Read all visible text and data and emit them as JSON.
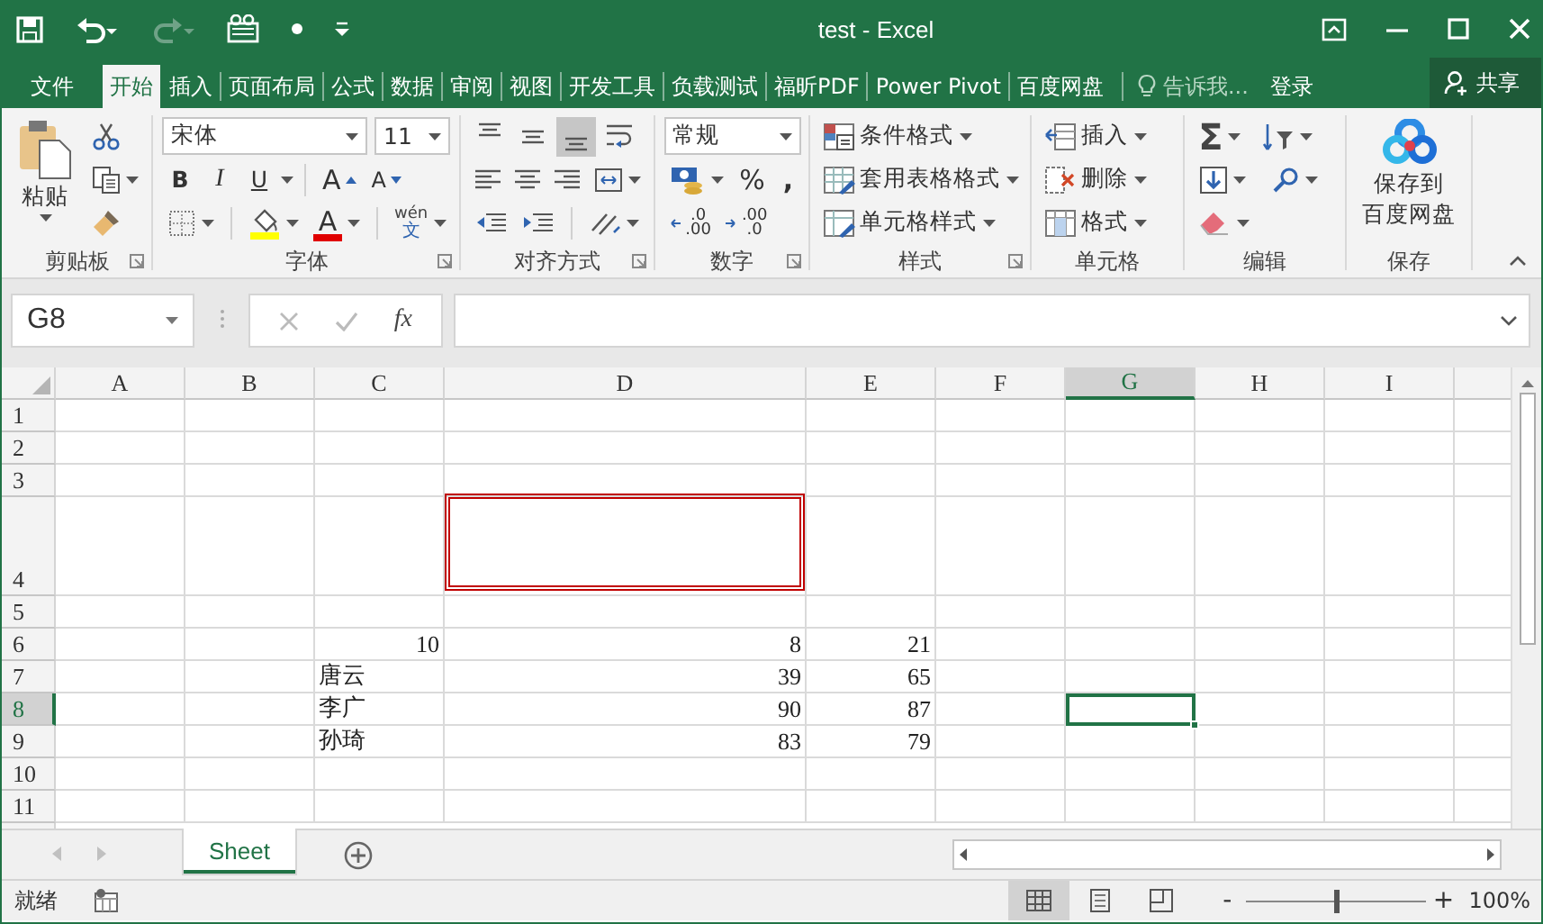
{
  "title_bar": {
    "title": "test - Excel",
    "quick_access": [
      {
        "kind": "save",
        "disabled": false
      },
      {
        "kind": "undo",
        "disabled": false
      },
      {
        "kind": "redo",
        "disabled": true
      },
      {
        "kind": "form",
        "disabled": false
      },
      {
        "kind": "dot",
        "disabled": false
      },
      {
        "kind": "customize",
        "disabled": false
      }
    ]
  },
  "ribbon_tabs": [
    {
      "label": "文件",
      "selected": false
    },
    {
      "label": "开始",
      "selected": true
    },
    {
      "label": "插入",
      "selected": false
    },
    {
      "label": "页面布局",
      "selected": false
    },
    {
      "label": "公式",
      "selected": false
    },
    {
      "label": "数据",
      "selected": false
    },
    {
      "label": "审阅",
      "selected": false
    },
    {
      "label": "视图",
      "selected": false
    },
    {
      "label": "开发工具",
      "selected": false
    },
    {
      "label": "负载测试",
      "selected": false
    },
    {
      "label": "福昕PDF",
      "selected": false
    },
    {
      "label": "Power Pivot",
      "selected": false
    },
    {
      "label": "百度网盘",
      "selected": false
    }
  ],
  "tell_me": {
    "placeholder": "告诉我..."
  },
  "sign_in": "登录",
  "share": "共享",
  "ribbon_groups": [
    {
      "kind": "clipboard",
      "label": "剪贴板",
      "launcher": true,
      "paste": "粘贴"
    },
    {
      "kind": "font",
      "label": "字体",
      "launcher": true,
      "font_name": "宋体",
      "font_size": "11",
      "bold": "B",
      "italic": "I",
      "underline": "U",
      "grow_font": "A",
      "shrink_font": "A",
      "font_color": "A",
      "phonetic": [
        "wén",
        "文"
      ]
    },
    {
      "kind": "alignment",
      "label": "对齐方式",
      "launcher": true,
      "vertical_align_buttons": [
        {
          "selected": false
        },
        {
          "selected": false
        },
        {
          "selected": true
        }
      ]
    },
    {
      "kind": "number",
      "label": "数字",
      "launcher": true,
      "format": "常规",
      "percent": "%",
      "comma": ",",
      "increase_decimal": [
        ".0",
        ".00"
      ],
      "decrease_decimal": [
        ".00",
        ".0"
      ]
    },
    {
      "kind": "styles",
      "label": "样式",
      "launcher": true,
      "buttons": [
        "条件格式",
        "套用表格格式",
        "单元格样式"
      ]
    },
    {
      "kind": "cells",
      "label": "单元格",
      "launcher": false,
      "buttons": [
        "插入",
        "删除",
        "格式"
      ]
    },
    {
      "kind": "editing",
      "label": "编辑",
      "launcher": false,
      "autosum": "Σ"
    },
    {
      "kind": "save",
      "label": "保存",
      "launcher": false,
      "button_lines": [
        "保存到",
        "百度网盘"
      ]
    }
  ],
  "formula_bar": {
    "name_box": "G8",
    "function_button": "fx"
  },
  "grid": {
    "columns": [
      {
        "label": "A",
        "selected": false
      },
      {
        "label": "B",
        "selected": false
      },
      {
        "label": "C",
        "selected": false
      },
      {
        "label": "D",
        "selected": false
      },
      {
        "label": "E",
        "selected": false
      },
      {
        "label": "F",
        "selected": false
      },
      {
        "label": "G",
        "selected": true
      },
      {
        "label": "H",
        "selected": false
      },
      {
        "label": "I",
        "selected": false
      }
    ],
    "rows": [
      {
        "label": "1",
        "selected": false
      },
      {
        "label": "2",
        "selected": false
      },
      {
        "label": "3",
        "selected": false
      },
      {
        "label": "4",
        "selected": false,
        "cells": {
          "D": {
            "kind": "shape"
          }
        }
      },
      {
        "label": "5",
        "selected": false
      },
      {
        "label": "6",
        "selected": false,
        "cells": {
          "C": {
            "kind": "number",
            "text": "10"
          },
          "D": {
            "kind": "number",
            "text": "8"
          },
          "E": {
            "kind": "number",
            "text": "21"
          }
        }
      },
      {
        "label": "7",
        "selected": false,
        "cells": {
          "C": {
            "kind": "text",
            "text": "唐云"
          },
          "D": {
            "kind": "number",
            "text": "39"
          },
          "E": {
            "kind": "number",
            "text": "65"
          }
        }
      },
      {
        "label": "8",
        "selected": true,
        "cells": {
          "C": {
            "kind": "text",
            "text": "李广"
          },
          "D": {
            "kind": "number",
            "text": "90"
          },
          "E": {
            "kind": "number",
            "text": "87"
          }
        }
      },
      {
        "label": "9",
        "selected": false,
        "cells": {
          "C": {
            "kind": "text",
            "text": "孙琦"
          },
          "D": {
            "kind": "number",
            "text": "83"
          },
          "E": {
            "kind": "number",
            "text": "79"
          }
        }
      },
      {
        "label": "10",
        "selected": false
      },
      {
        "label": "11",
        "selected": false
      }
    ]
  },
  "sheet_tabs": [
    {
      "label": "Sheet",
      "selected": true
    }
  ],
  "status_bar": {
    "status": "就绪",
    "views": [
      {
        "kind": "normal",
        "selected": true
      },
      {
        "kind": "page_layout",
        "selected": false
      },
      {
        "kind": "page_break",
        "selected": false
      }
    ],
    "zoom_out": "-",
    "zoom_in": "+",
    "zoom": {
      "level": 0.5
    },
    "zoom_reading": "100%"
  }
}
